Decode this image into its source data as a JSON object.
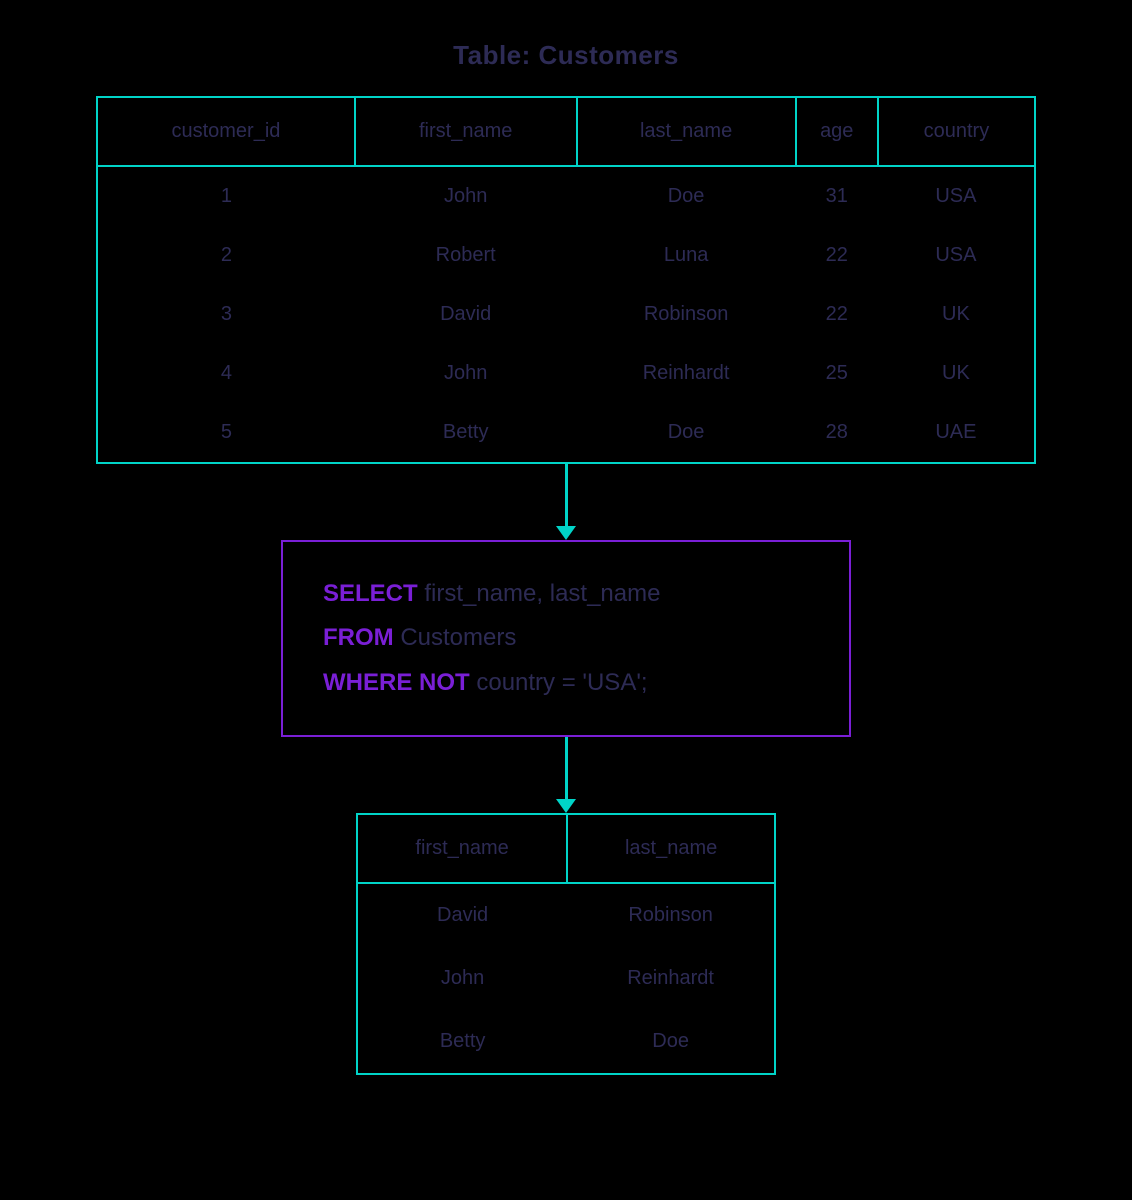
{
  "title": "Table: Customers",
  "source": {
    "headers": [
      "customer_id",
      "first_name",
      "last_name",
      "age",
      "country"
    ],
    "rows": [
      [
        "1",
        "John",
        "Doe",
        "31",
        "USA"
      ],
      [
        "2",
        "Robert",
        "Luna",
        "22",
        "USA"
      ],
      [
        "3",
        "David",
        "Robinson",
        "22",
        "UK"
      ],
      [
        "4",
        "John",
        "Reinhardt",
        "25",
        "UK"
      ],
      [
        "5",
        "Betty",
        "Doe",
        "28",
        "UAE"
      ]
    ]
  },
  "sql": {
    "kw_select": "SELECT",
    "select_cols": " first_name, last_name",
    "kw_from": "FROM",
    "from_table": " Customers",
    "kw_where_not": "WHERE NOT",
    "where_cond": " country = 'USA';"
  },
  "result": {
    "headers": [
      "first_name",
      "last_name"
    ],
    "rows": [
      [
        "David",
        "Robinson"
      ],
      [
        "John",
        "Reinhardt"
      ],
      [
        "Betty",
        "Doe"
      ]
    ]
  }
}
